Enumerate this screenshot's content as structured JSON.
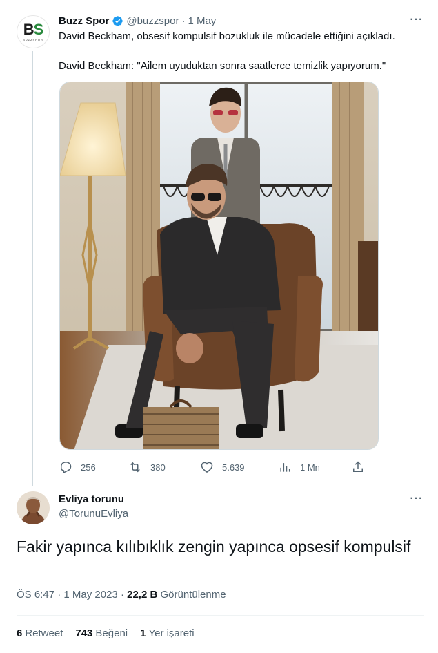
{
  "parent_tweet": {
    "avatar_text": "BS",
    "avatar_subtext": "BUZZSPOR",
    "author_name": "Buzz Spor",
    "handle": "@buzzspor",
    "separator": "·",
    "date": "1 May",
    "more_icon": "···",
    "text_line1": "David Beckham, obsesif kompulsif bozukluk ile mücadele ettiğini açıkladı.",
    "text_line2": "David Beckham: \"Ailem uyuduktan sonra saatlerce temizlik yapıyorum.\"",
    "actions": {
      "replies": "256",
      "retweets": "380",
      "likes": "5.639",
      "views": "1 Mn"
    }
  },
  "reply_tweet": {
    "author_name": "Evliya torunu",
    "handle": "@TorunuEvliya",
    "more_icon": "···",
    "text": "Fakir yapınca kılıbıklık zengin yapınca opsesif kompulsif",
    "time": "ÖS 6:47",
    "separator": "·",
    "date": "1 May 2023",
    "views_count": "22,2 B",
    "views_label": "Görüntülenme",
    "stats": {
      "retweet_count": "6",
      "retweet_label": "Retweet",
      "like_count": "743",
      "like_label": "Beğeni",
      "bookmark_count": "1",
      "bookmark_label": "Yer işareti"
    }
  },
  "colors": {
    "text_primary": "#0f1419",
    "text_secondary": "#536471",
    "verified_blue": "#1d9bf0",
    "divider": "#eff3f4"
  }
}
